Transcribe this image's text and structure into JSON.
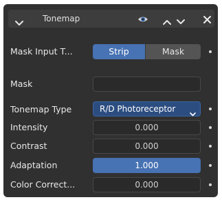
{
  "header": {
    "title": "Tonemap",
    "close_glyph": "✕"
  },
  "mask_input_type": {
    "label": "Mask Input T...",
    "options": [
      "Strip",
      "Mask"
    ],
    "selected": "Strip"
  },
  "mask": {
    "label": "Mask",
    "value": ""
  },
  "tonemap_type": {
    "label": "Tonemap Type",
    "value": "R/D Photoreceptor"
  },
  "intensity": {
    "label": "Intensity",
    "value": "0.000"
  },
  "contrast": {
    "label": "Contrast",
    "value": "0.000"
  },
  "adaptation": {
    "label": "Adaptation",
    "value": "1.000"
  },
  "color_correction": {
    "label": "Color Correct...",
    "value": "0.000"
  },
  "colors": {
    "panel_bg": "#303030",
    "header_bg": "#3d3d3d",
    "accent": "#4772b3",
    "field_bg": "#545454"
  },
  "icons": {
    "collapse": "chevron-down-icon",
    "visibility": "eye-icon",
    "move_up": "triangle-up-icon",
    "move_down": "chevron-down-icon",
    "remove": "close-icon"
  }
}
